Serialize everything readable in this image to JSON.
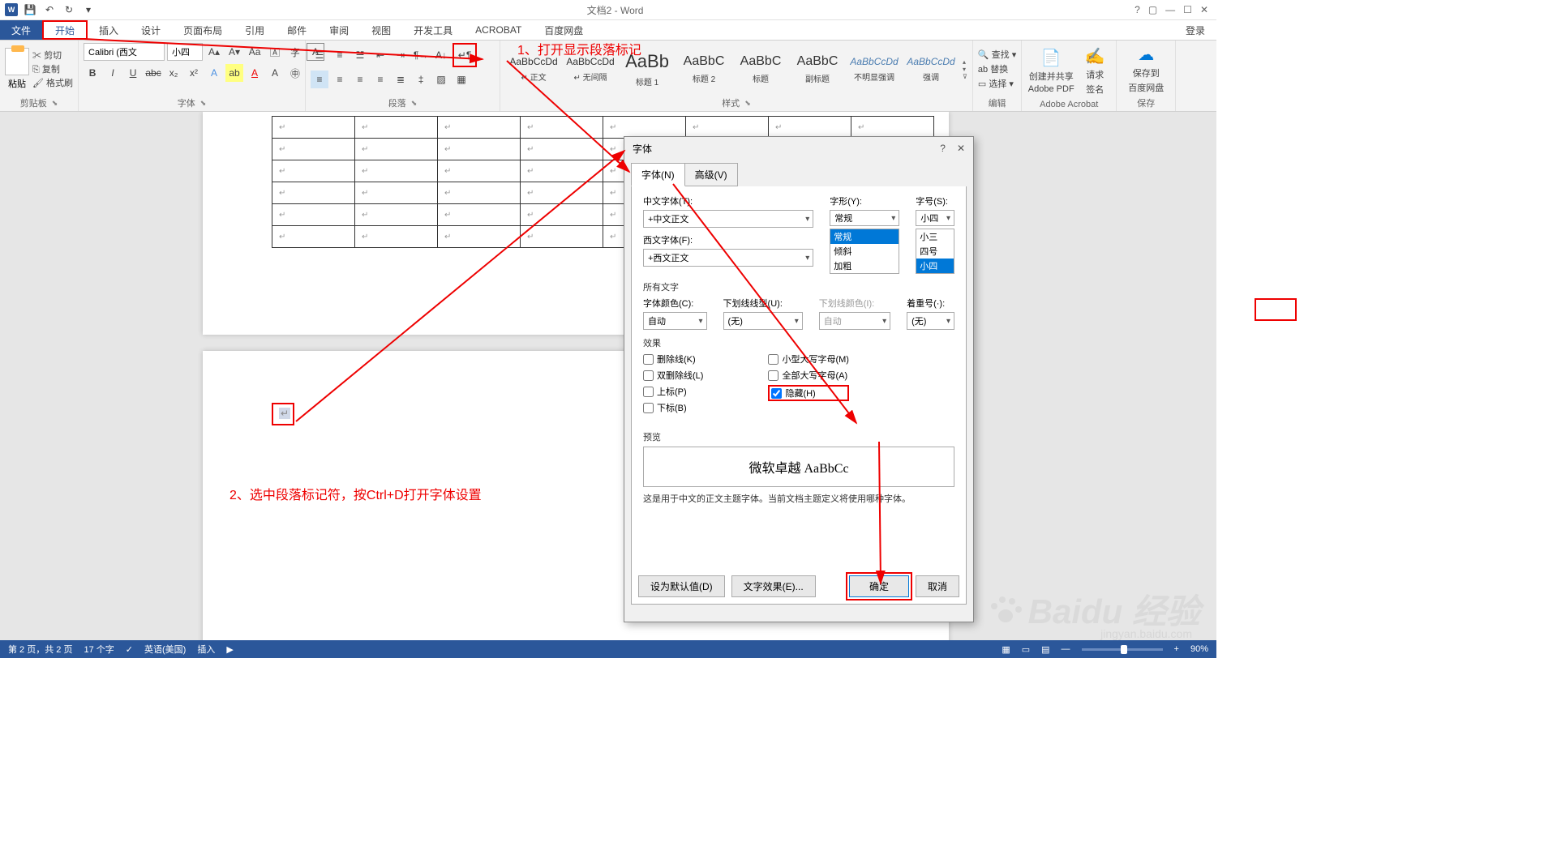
{
  "titlebar": {
    "title": "文档2 - Word",
    "help": "?",
    "login": "登录"
  },
  "tabs": {
    "file": "文件",
    "home": "开始",
    "insert": "插入",
    "design": "设计",
    "layout": "页面布局",
    "references": "引用",
    "mailings": "邮件",
    "review": "审阅",
    "view": "视图",
    "developer": "开发工具",
    "acrobat": "ACROBAT",
    "baidu": "百度网盘"
  },
  "ribbon": {
    "clipboard": {
      "label": "剪贴板",
      "paste": "粘贴",
      "cut": "剪切",
      "copy": "复制",
      "format": "格式刷"
    },
    "font": {
      "label": "字体",
      "name": "Calibri (西文",
      "size": "小四"
    },
    "paragraph": {
      "label": "段落"
    },
    "styles": {
      "label": "样式",
      "items": [
        {
          "preview": "AaBbCcDd",
          "name": "↵ 正文"
        },
        {
          "preview": "AaBbCcDd",
          "name": "↵ 无间隔"
        },
        {
          "preview": "AaBb",
          "name": "标题 1"
        },
        {
          "preview": "AaBbC",
          "name": "标题 2"
        },
        {
          "preview": "AaBbC",
          "name": "标题"
        },
        {
          "preview": "AaBbC",
          "name": "副标题"
        },
        {
          "preview": "AaBbCcDd",
          "name": "不明显强调"
        },
        {
          "preview": "AaBbCcDd",
          "name": "强调"
        }
      ]
    },
    "editing": {
      "label": "编辑",
      "find": "查找",
      "replace": "替换",
      "select": "选择"
    },
    "acrobat": {
      "label": "Adobe Acrobat",
      "create": "创建并共享",
      "createL2": "Adobe PDF",
      "sign": "请求",
      "signL2": "签名"
    },
    "baidu": {
      "label": "保存",
      "save": "保存到",
      "saveL2": "百度网盘"
    }
  },
  "annotations": {
    "a1": "1、打开显示段落标记",
    "a2": "2、选中段落标记符，按Ctrl+D打开字体设置"
  },
  "dialog": {
    "title": "字体",
    "tab_font": "字体(N)",
    "tab_adv": "高级(V)",
    "cn_label": "中文字体(T):",
    "cn_val": "+中文正文",
    "west_label": "西文字体(F):",
    "west_val": "+西文正文",
    "style_label": "字形(Y):",
    "style_val": "常规",
    "style_opts": [
      "常规",
      "倾斜",
      "加粗"
    ],
    "size_label": "字号(S):",
    "size_val": "小四",
    "size_opts": [
      "小三",
      "四号",
      "小四"
    ],
    "all_text": "所有文字",
    "color_label": "字体颜色(C):",
    "color_val": "自动",
    "underline_label": "下划线线型(U):",
    "underline_val": "(无)",
    "ucolor_label": "下划线颜色(I):",
    "ucolor_val": "自动",
    "emphasis_label": "着重号(·):",
    "emphasis_val": "(无)",
    "effects": "效果",
    "strike": "删除线(K)",
    "dstrike": "双删除线(L)",
    "sup": "上标(P)",
    "sub": "下标(B)",
    "smallcaps": "小型大写字母(M)",
    "allcaps": "全部大写字母(A)",
    "hidden": "隐藏(H)",
    "preview_label": "预览",
    "preview_text": "微软卓越 AaBbCc",
    "note": "这是用于中文的正文主题字体。当前文档主题定义将使用哪种字体。",
    "default_btn": "设为默认值(D)",
    "effects_btn": "文字效果(E)...",
    "ok": "确定",
    "cancel": "取消"
  },
  "statusbar": {
    "page": "第 2 页，共 2 页",
    "words": "17 个字",
    "lang": "英语(美国)",
    "mode": "插入",
    "zoom": "90%"
  },
  "watermark": {
    "main": "Baidu 经验",
    "sub": "jingyan.baidu.com"
  }
}
